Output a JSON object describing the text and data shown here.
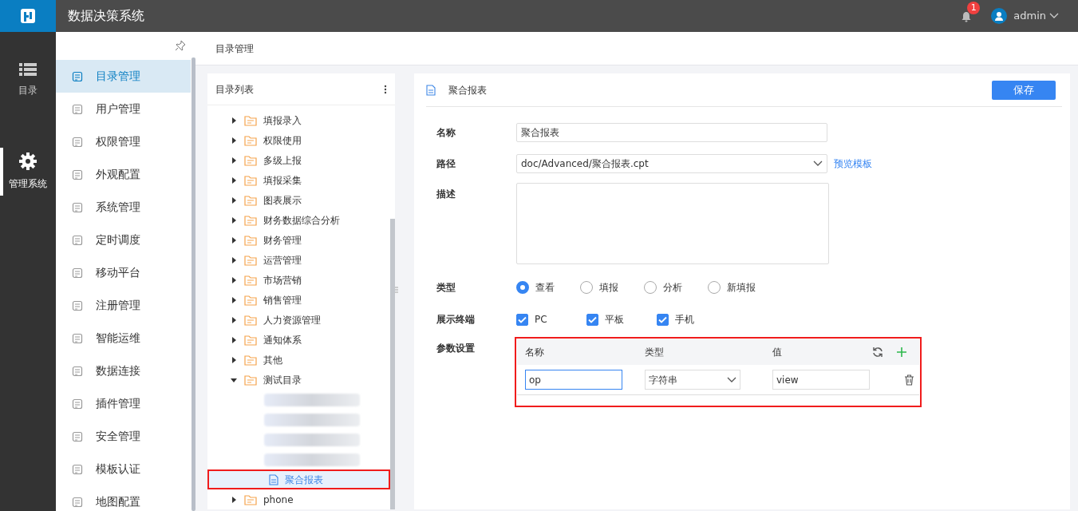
{
  "header": {
    "title": "数据决策系统",
    "notification_count": "1",
    "user": "admin"
  },
  "rail": [
    {
      "label": "目录",
      "selected": false,
      "kind": "list"
    },
    {
      "label": "管理系统",
      "selected": true,
      "kind": "gear"
    }
  ],
  "sidebar": {
    "items": [
      {
        "label": "目录管理",
        "selected": true
      },
      {
        "label": "用户管理",
        "selected": false
      },
      {
        "label": "权限管理",
        "selected": false
      },
      {
        "label": "外观配置",
        "selected": false
      },
      {
        "label": "系统管理",
        "selected": false
      },
      {
        "label": "定时调度",
        "selected": false
      },
      {
        "label": "移动平台",
        "selected": false
      },
      {
        "label": "注册管理",
        "selected": false
      },
      {
        "label": "智能运维",
        "selected": false
      },
      {
        "label": "数据连接",
        "selected": false
      },
      {
        "label": "插件管理",
        "selected": false
      },
      {
        "label": "安全管理",
        "selected": false
      },
      {
        "label": "模板认证",
        "selected": false
      },
      {
        "label": "地图配置",
        "selected": false
      }
    ]
  },
  "breadcrumb": "目录管理",
  "tree": {
    "title": "目录列表",
    "items": [
      {
        "label": "填报录入",
        "kind": "folder",
        "expanded": false
      },
      {
        "label": "权限使用",
        "kind": "folder",
        "expanded": false
      },
      {
        "label": "多级上报",
        "kind": "folder",
        "expanded": false
      },
      {
        "label": "填报采集",
        "kind": "folder",
        "expanded": false
      },
      {
        "label": "图表展示",
        "kind": "folder",
        "expanded": false
      },
      {
        "label": "财务数据综合分析",
        "kind": "folder",
        "expanded": false
      },
      {
        "label": "财务管理",
        "kind": "folder",
        "expanded": false
      },
      {
        "label": "运营管理",
        "kind": "folder",
        "expanded": false
      },
      {
        "label": "市场营销",
        "kind": "folder",
        "expanded": false
      },
      {
        "label": "销售管理",
        "kind": "folder",
        "expanded": false
      },
      {
        "label": "人力资源管理",
        "kind": "folder",
        "expanded": false
      },
      {
        "label": "通知体系",
        "kind": "folder",
        "expanded": false
      },
      {
        "label": "其他",
        "kind": "folder",
        "expanded": false
      },
      {
        "label": "测试目录",
        "kind": "folder",
        "expanded": true,
        "children": [
          {
            "kind": "redacted"
          },
          {
            "kind": "redacted"
          },
          {
            "kind": "redacted"
          },
          {
            "kind": "redacted"
          },
          {
            "label": "聚合报表",
            "kind": "file",
            "selected": true,
            "highlighted": true
          }
        ]
      },
      {
        "label": "phone",
        "kind": "folder",
        "expanded": false
      }
    ]
  },
  "editor": {
    "title": "聚合报表",
    "save": "保存",
    "fields": [
      {
        "label": "名称",
        "kind": "text",
        "value": "聚合报表"
      },
      {
        "label": "路径",
        "kind": "select",
        "value": "doc/Advanced/聚合报表.cpt",
        "link": "预览模板"
      },
      {
        "label": "描述",
        "kind": "textarea"
      },
      {
        "label": "类型",
        "kind": "radio",
        "options": [
          {
            "label": "查看",
            "selected": true
          },
          {
            "label": "填报",
            "selected": false
          },
          {
            "label": "分析",
            "selected": false
          },
          {
            "label": "新填报",
            "selected": false
          }
        ]
      },
      {
        "label": "展示终端",
        "kind": "checkbox",
        "options": [
          {
            "label": "PC",
            "checked": true
          },
          {
            "label": "平板",
            "checked": true
          },
          {
            "label": "手机",
            "checked": true
          }
        ]
      },
      {
        "label": "参数设置",
        "kind": "params",
        "highlighted": true,
        "columns": [
          "名称",
          "类型",
          "值"
        ],
        "rows": [
          {
            "name": "op",
            "type": "字符串",
            "value": "view"
          }
        ]
      }
    ]
  }
}
